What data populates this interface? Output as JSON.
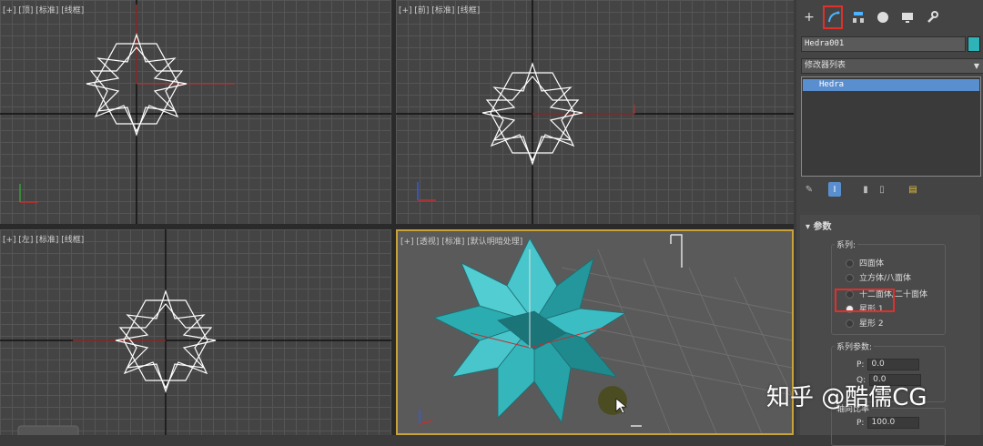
{
  "viewports": {
    "top": {
      "label": "[+] [顶] [标准] [线框]"
    },
    "front": {
      "label": "[+] [前] [标准] [线框]"
    },
    "left": {
      "label": "[+] [左] [标准] [线框]"
    },
    "perspective": {
      "label": "[+] [透视] [标准] [默认明暗处理]"
    }
  },
  "command_panel": {
    "tabs": [
      "create-icon",
      "modify-icon",
      "hierarchy-icon",
      "motion-icon",
      "display-icon",
      "utilities-icon"
    ],
    "object_name": "Hedra001",
    "object_color": "#2eb3b8",
    "modifier_list": "修改器列表",
    "stack_item": "Hedra",
    "params": {
      "title": "参数",
      "family_label": "系列:",
      "family_options": [
        "四面体",
        "立方体/八面体",
        "十二面体/二十面体",
        "星形 1",
        "星形 2"
      ],
      "family_selected": "星形 1",
      "family_params_label": "系列参数:",
      "p_label": "P:",
      "p_value": "0.0",
      "q_label": "Q:",
      "q_value": "0.0",
      "axis_scale_label": "轴向比率",
      "axis_p_label": "P:",
      "axis_p_value": "100.0"
    }
  },
  "colors": {
    "accent": "#5a8fcf",
    "object": "#2eb3b8",
    "highlight": "#e0302c"
  },
  "watermark": "知乎 @酷儒CG"
}
